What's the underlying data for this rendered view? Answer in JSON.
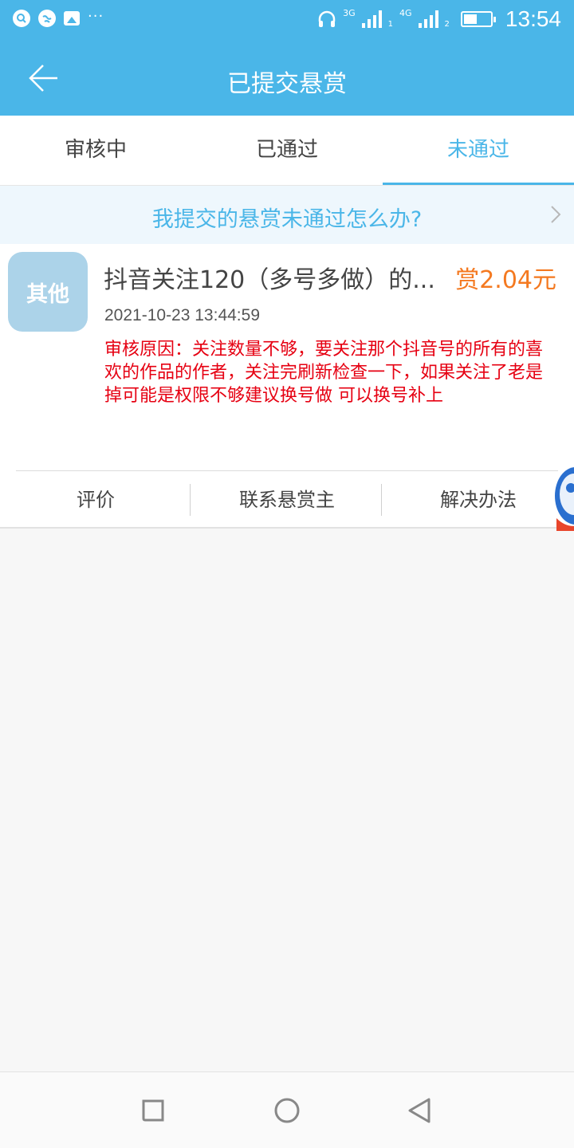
{
  "status_bar": {
    "time": "13:54",
    "network1": "3G",
    "network2": "4G",
    "slot1": "1",
    "slot2": "2",
    "icons": [
      "search-app-icon",
      "globe-icon",
      "image-icon",
      "more-dots-icon",
      "headset-icon",
      "signal-icon",
      "battery-icon"
    ]
  },
  "header": {
    "title": "已提交悬赏",
    "back_icon": "arrow-left-icon"
  },
  "tabs": [
    {
      "label": "审核中",
      "active": false
    },
    {
      "label": "已通过",
      "active": false
    },
    {
      "label": "未通过",
      "active": true
    }
  ],
  "help_banner": {
    "text": "我提交的悬赏未通过怎么办?",
    "icon": "chevron-right-icon"
  },
  "task": {
    "category": "其他",
    "title": "抖音关注120（多号多做）的...",
    "reward": "赏2.04元",
    "time": "2021-10-23 13:44:59",
    "reason": "审核原因：关注数量不够，要关注那个抖音号的所有的喜欢的作品的作者，关注完刷新检查一下，如果关注了老是掉可能是权限不够建议换号做 可以换号补上"
  },
  "actions": {
    "review": "评价",
    "contact": "联系悬赏主",
    "solution": "解决办法"
  },
  "colors": {
    "primary": "#4ab6e8",
    "reward": "#f47920",
    "reason": "#e60012",
    "badge": "#acd3e9"
  },
  "nav": {
    "icons": [
      "recent-apps-icon",
      "home-icon",
      "back-triangle-icon"
    ]
  }
}
